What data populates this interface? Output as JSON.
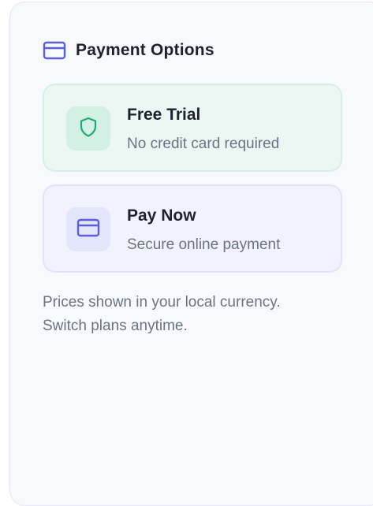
{
  "header": {
    "title": "Payment Options",
    "icon": "credit-card-icon",
    "icon_color": "#5b5fd6"
  },
  "options": [
    {
      "title": "Free Trial",
      "subtitle": "No credit card required",
      "icon": "shield-icon",
      "accent": "#1fa87a"
    },
    {
      "title": "Pay Now",
      "subtitle": "Secure online payment",
      "icon": "credit-card-icon",
      "accent": "#5b5fd6"
    }
  ],
  "note": {
    "line1": "Prices shown in your local currency.",
    "line2": "Switch plans anytime."
  }
}
